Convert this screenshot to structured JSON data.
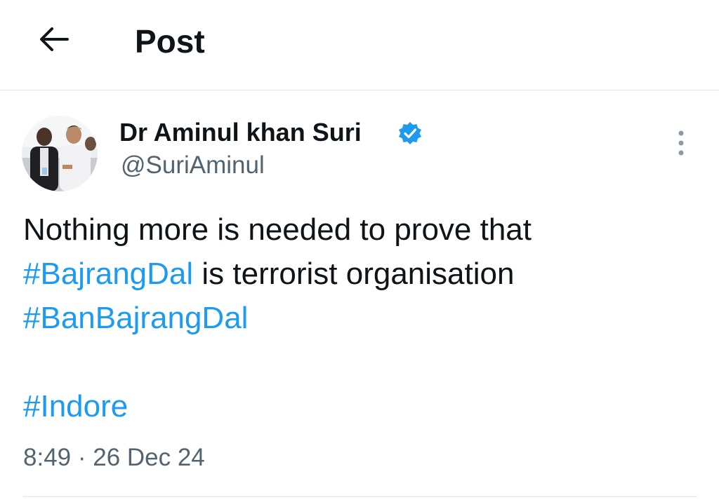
{
  "header": {
    "title": "Post",
    "back_icon": "arrow-left-icon"
  },
  "tweet": {
    "author_name": "Dr Aminul khan Suri",
    "author_handle": "@SuriAminul",
    "verified_icon": "verified-badge-icon",
    "more_icon": "more-vertical-icon",
    "text_line1": "Nothing more is needed to prove that",
    "hashtag1": "#BajrangDal",
    "text_line2_rest": " is terrorist organisation",
    "hashtag2": "#BanBajrangDal",
    "hashtag3": "#Indore",
    "timestamp": "8:49 · 26 Dec 24"
  },
  "colors": {
    "link": "#1d9bf0",
    "text": "#0f1419",
    "secondary": "#536471",
    "divider": "#dfe5ea"
  }
}
